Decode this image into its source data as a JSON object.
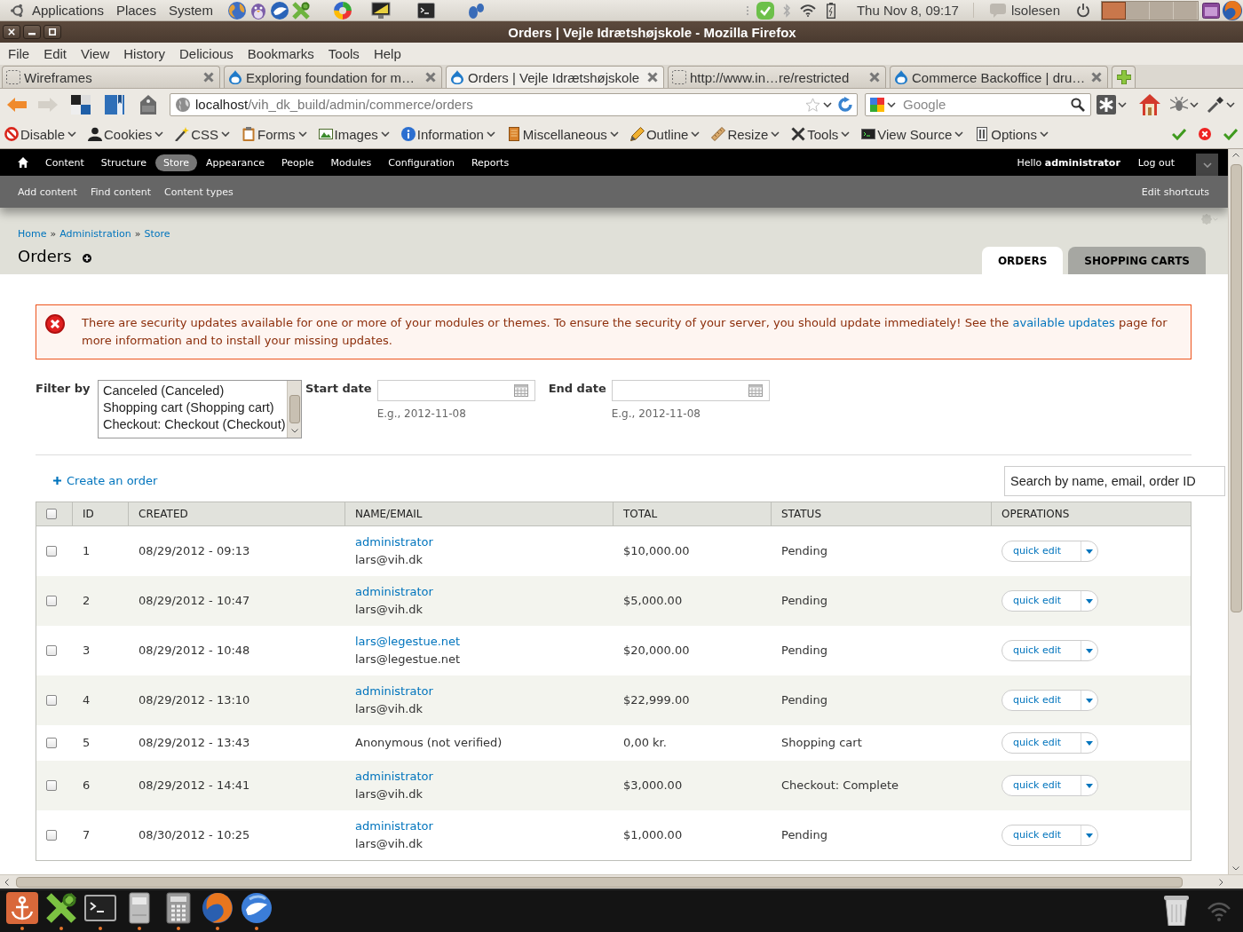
{
  "top_panel": {
    "menus": [
      "Applications",
      "Places",
      "System"
    ],
    "clock": "Thu Nov 8, 09:17",
    "user": "lsolesen",
    "workspaces": [
      {
        "selected": true
      },
      {
        "selected": false
      },
      {
        "selected": false
      },
      {
        "selected": false
      }
    ]
  },
  "window": {
    "title": "Orders | Vejle Idrætshøjskole - Mozilla Firefox"
  },
  "menubar": [
    "File",
    "Edit",
    "View",
    "History",
    "Delicious",
    "Bookmarks",
    "Tools",
    "Help"
  ],
  "browser_tabs": [
    {
      "label": "Wireframes",
      "kind": "blank",
      "selected": false
    },
    {
      "label": "Exploring foundation for m…",
      "kind": "drupal",
      "selected": false
    },
    {
      "label": "Orders | Vejle Idrætshøjskole",
      "kind": "drupal",
      "selected": true
    },
    {
      "label": "http://www.in…re/restricted",
      "kind": "blank",
      "selected": false
    },
    {
      "label": "Commerce Backoffice | dru…",
      "kind": "drupal",
      "selected": false
    }
  ],
  "address_bar": {
    "host": "localhost",
    "path": "/vih_dk_build/admin/commerce/orders"
  },
  "search_bar": {
    "placeholder": "Google"
  },
  "dev_toolbar": [
    "Disable",
    "Cookies",
    "CSS",
    "Forms",
    "Images",
    "Information",
    "Miscellaneous",
    "Outline",
    "Resize",
    "Tools",
    "View Source",
    "Options"
  ],
  "admin_toolbar": {
    "items": [
      {
        "label": "Content",
        "selected": false
      },
      {
        "label": "Structure",
        "selected": false
      },
      {
        "label": "Store",
        "selected": true
      },
      {
        "label": "Appearance",
        "selected": false
      },
      {
        "label": "People",
        "selected": false
      },
      {
        "label": "Modules",
        "selected": false
      },
      {
        "label": "Configuration",
        "selected": false
      },
      {
        "label": "Reports",
        "selected": false
      }
    ],
    "greeting": "Hello **administrator**",
    "logout": "Log out"
  },
  "shortcuts": {
    "items": [
      "Add content",
      "Find content",
      "Content types"
    ],
    "edit": "Edit shortcuts"
  },
  "breadcrumb": {
    "items": [
      "Home",
      "Administration",
      "Store"
    ],
    "separators": [
      "»",
      "»"
    ]
  },
  "page": {
    "title": "Orders",
    "tabs": [
      {
        "label": "ORDERS",
        "selected": true
      },
      {
        "label": "SHOPPING CARTS",
        "selected": false
      }
    ]
  },
  "message": {
    "kind": "error",
    "text_before": "There are security updates available for one or more of your modules or themes. To ensure the security of your server, you should update immediately! See the",
    "link": "available updates",
    "text_after": "page for more information and to install your missing updates."
  },
  "filter": {
    "label": "Filter by",
    "options": [
      {
        "label": "Canceled (Canceled)",
        "selected": false
      },
      {
        "label": "Shopping cart (Shopping cart)",
        "selected": false
      },
      {
        "label": "Checkout: Checkout (Checkout)",
        "selected": false
      }
    ],
    "start_date": {
      "label": "Start date",
      "hint": "E.g., 2012-11-08"
    },
    "end_date": {
      "label": "End date",
      "hint": "E.g., 2012-11-08"
    }
  },
  "create_link": "Create an order",
  "search": {
    "placeholder": "Search by name, email, order ID"
  },
  "table": {
    "select_all": {
      "checked": false
    },
    "columns": [
      "ID",
      "CREATED",
      "NAME/EMAIL",
      "TOTAL",
      "STATUS",
      "OPERATIONS"
    ],
    "rows": [
      {
        "kind": "customer",
        "checked": false,
        "id": "1",
        "created": "08/29/2012 - 09:13",
        "name": "administrator",
        "email": "lars@vih.dk",
        "total": "$10,000.00",
        "status": "Pending",
        "operation": "quick edit"
      },
      {
        "kind": "customer",
        "checked": false,
        "id": "2",
        "created": "08/29/2012 - 10:47",
        "name": "administrator",
        "email": "lars@vih.dk",
        "total": "$5,000.00",
        "status": "Pending",
        "operation": "quick edit"
      },
      {
        "kind": "customer",
        "checked": false,
        "id": "3",
        "created": "08/29/2012 - 10:48",
        "name": "lars@legestue.net",
        "email": "lars@legestue.net",
        "total": "$20,000.00",
        "status": "Pending",
        "operation": "quick edit"
      },
      {
        "kind": "customer",
        "checked": false,
        "id": "4",
        "created": "08/29/2012 - 13:10",
        "name": "administrator",
        "email": "lars@vih.dk",
        "total": "$22,999.00",
        "status": "Pending",
        "operation": "quick edit"
      },
      {
        "kind": "anonymous",
        "checked": false,
        "id": "5",
        "created": "08/29/2012 - 13:43",
        "name": "Anonymous (not verified)",
        "total": "0,00 kr.",
        "status": "Shopping cart",
        "operation": "quick edit"
      },
      {
        "kind": "customer",
        "checked": false,
        "id": "6",
        "created": "08/29/2012 - 14:41",
        "name": "administrator",
        "email": "lars@vih.dk",
        "total": "$3,000.00",
        "status": "Checkout: Complete",
        "operation": "quick edit"
      },
      {
        "kind": "customer",
        "checked": false,
        "id": "7",
        "created": "08/30/2012 - 10:25",
        "name": "administrator",
        "email": "lars@vih.dk",
        "total": "$1,000.00",
        "status": "Pending",
        "operation": "quick edit"
      }
    ]
  },
  "taskbar": {
    "launchers": [
      {
        "running": true
      },
      {
        "running": true
      },
      {
        "running": true
      },
      {
        "running": true
      },
      {
        "running": true
      },
      {
        "running": true
      },
      {
        "running": true
      }
    ]
  }
}
